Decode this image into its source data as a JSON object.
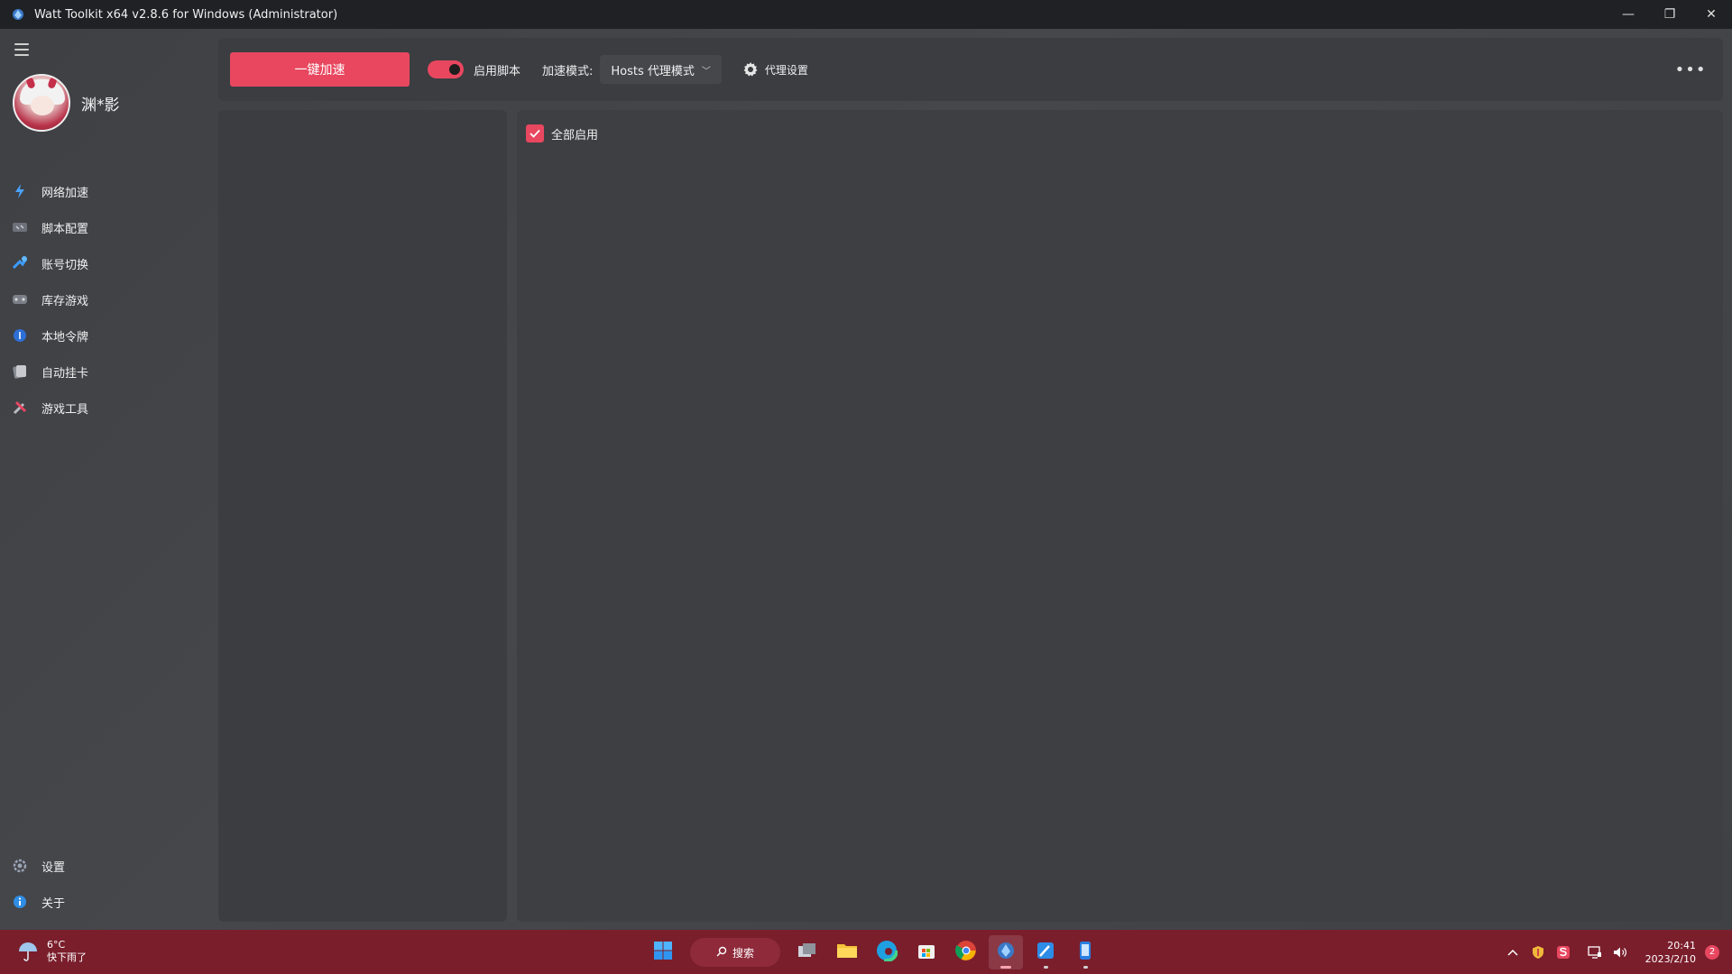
{
  "window": {
    "title": "Watt Toolkit x64 v2.8.6 for Windows (Administrator)",
    "controls": {
      "minimize": "—",
      "restore": "❐",
      "close": "✕"
    }
  },
  "sidebar": {
    "username": "渊*影",
    "items": [
      {
        "label": "网络加速",
        "icon": "lightning-icon"
      },
      {
        "label": "脚本配置",
        "icon": "script-icon"
      },
      {
        "label": "账号切换",
        "icon": "account-switch-icon"
      },
      {
        "label": "库存游戏",
        "icon": "game-library-icon"
      },
      {
        "label": "本地令牌",
        "icon": "token-icon"
      },
      {
        "label": "自动挂卡",
        "icon": "card-icon"
      },
      {
        "label": "游戏工具",
        "icon": "tools-icon"
      }
    ],
    "bottom_items": [
      {
        "label": "设置",
        "icon": "gear-icon"
      },
      {
        "label": "关于",
        "icon": "info-icon"
      }
    ]
  },
  "toolbar": {
    "accelerate_label": "一键加速",
    "enable_script_label": "启用脚本",
    "enable_script_on": true,
    "mode_label": "加速模式:",
    "mode_value": "Hosts 代理模式",
    "proxy_settings_label": "代理设置",
    "more_label": "•••"
  },
  "content": {
    "enable_all_label": "全部启用",
    "enable_all_checked": true
  },
  "taskbar": {
    "weather_temp": "6°C",
    "weather_desc": "快下雨了",
    "search_label": "搜索",
    "time": "20:41",
    "date": "2023/2/10",
    "notification_count": "2"
  },
  "colors": {
    "accent": "#e8475f",
    "taskbar": "#7a1e2c",
    "titlebar": "#202124"
  }
}
